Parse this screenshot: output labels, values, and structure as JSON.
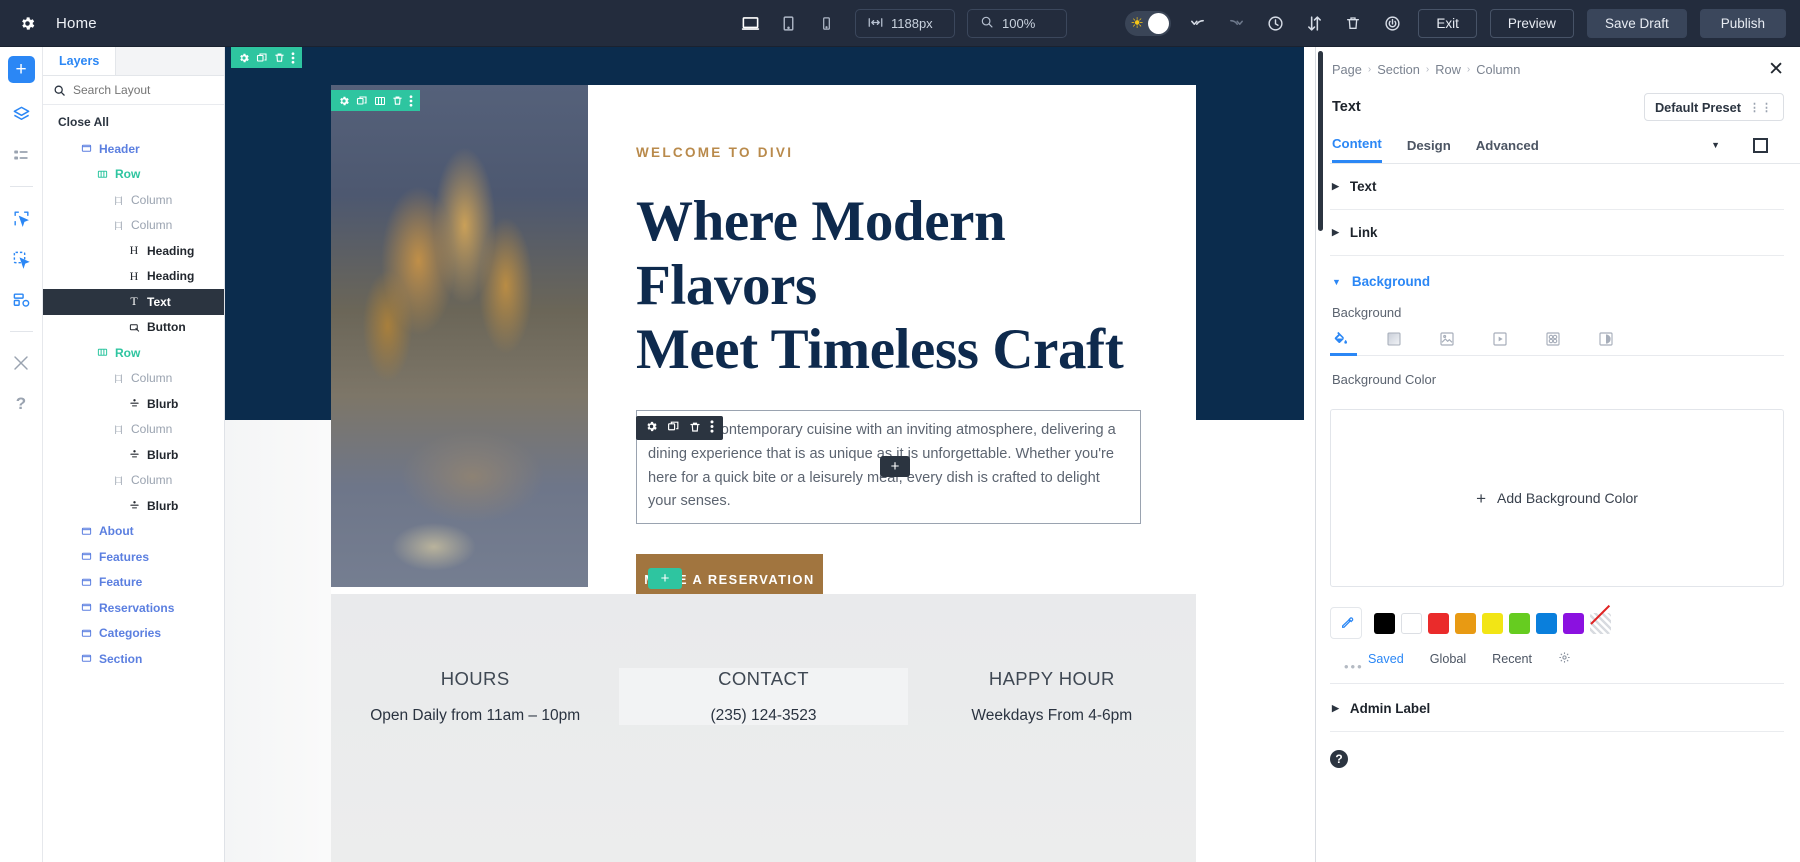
{
  "topbar": {
    "gear_icon": "gear-icon",
    "page_title": "Home",
    "devices": [
      {
        "name": "desktop",
        "icon": "desktop-icon",
        "active": true
      },
      {
        "name": "tablet",
        "icon": "tablet-icon",
        "active": false
      },
      {
        "name": "phone",
        "icon": "phone-icon",
        "active": false
      }
    ],
    "width_value": "1188px",
    "width_icon": "width-arrows-icon",
    "zoom_value": "100%",
    "zoom_icon": "magnifier-icon",
    "wireframe_toggle_icon": "sun-toggle-icon",
    "undo_icon": "undo-icon",
    "redo_icon": "redo-icon",
    "history_icon": "clock-history-icon",
    "portability_icon": "up-down-arrows-icon",
    "trash_icon": "trash-icon",
    "power_icon": "power-icon",
    "exit_label": "Exit",
    "preview_label": "Preview",
    "save_draft_label": "Save Draft",
    "publish_label": "Publish"
  },
  "rail": {
    "add_label": "+",
    "items": [
      {
        "name": "layers-icon"
      },
      {
        "name": "list-view-icon"
      },
      {
        "name": "select-element-icon"
      },
      {
        "name": "multiselect-icon"
      },
      {
        "name": "wireframe-icon"
      },
      {
        "name": "tools-icon"
      },
      {
        "name": "help-icon"
      }
    ]
  },
  "layers": {
    "tab_label": "Layers",
    "search_placeholder": "Search Layout",
    "search_value": "",
    "search_icon": "search-icon",
    "filter_icon": "filter-icon",
    "close_all_label": "Close All",
    "tree": [
      {
        "label": "Header",
        "type": "section",
        "icon": "section-icon"
      },
      {
        "label": "Row",
        "type": "row",
        "icon": "row-icon"
      },
      {
        "label": "Column",
        "type": "column",
        "icon": "column-icon"
      },
      {
        "label": "Column",
        "type": "column",
        "icon": "column-icon"
      },
      {
        "label": "Heading",
        "type": "module",
        "icon": "heading-icon"
      },
      {
        "label": "Heading",
        "type": "module",
        "icon": "heading-icon"
      },
      {
        "label": "Text",
        "type": "module",
        "icon": "text-icon",
        "selected": true
      },
      {
        "label": "Button",
        "type": "module",
        "icon": "button-icon"
      },
      {
        "label": "Row",
        "type": "row",
        "icon": "row-icon"
      },
      {
        "label": "Column",
        "type": "column",
        "icon": "column-icon"
      },
      {
        "label": "Blurb",
        "type": "module",
        "icon": "blurb-icon"
      },
      {
        "label": "Column",
        "type": "column",
        "icon": "column-icon"
      },
      {
        "label": "Blurb",
        "type": "module",
        "icon": "blurb-icon"
      },
      {
        "label": "Column",
        "type": "column",
        "icon": "column-icon"
      },
      {
        "label": "Blurb",
        "type": "module",
        "icon": "blurb-icon"
      },
      {
        "label": "About",
        "type": "section",
        "icon": "section-icon"
      },
      {
        "label": "Features",
        "type": "section",
        "icon": "section-icon"
      },
      {
        "label": "Feature",
        "type": "section",
        "icon": "section-icon"
      },
      {
        "label": "Reservations",
        "type": "section",
        "icon": "section-icon"
      },
      {
        "label": "Categories",
        "type": "section",
        "icon": "section-icon"
      },
      {
        "label": "Section",
        "type": "section",
        "icon": "section-icon"
      }
    ]
  },
  "canvas": {
    "section_toolbar_icons": [
      "gear-icon",
      "duplicate-icon",
      "trash-icon",
      "more-icon"
    ],
    "row_toolbar_icons": [
      "gear-icon",
      "duplicate-icon",
      "columns-icon",
      "trash-icon",
      "more-icon"
    ],
    "module_toolbar_icons": [
      "gear-icon",
      "duplicate-icon",
      "trash-icon",
      "more-icon"
    ],
    "eyebrow": "WELCOME TO DIVI",
    "heading_line1": "Where Modern Flavors",
    "heading_line2": "Meet Timeless Craft",
    "paragraph": "We blend contemporary cuisine with an inviting atmosphere, delivering a dining experience that is as unique as it is unforgettable. Whether you're here for a quick bite or a leisurely meal, every dish is crafted to delight your senses.",
    "cta_label": "MAKE A RESERVATION",
    "add_module_label": "+",
    "add_row_label": "+",
    "footer": [
      {
        "title": "HOURS",
        "value": "Open Daily from 11am – 10pm",
        "highlight": false
      },
      {
        "title": "CONTACT",
        "value": "(235) 124-3523",
        "highlight": true
      },
      {
        "title": "HAPPY HOUR",
        "value": "Weekdays From 4-6pm",
        "highlight": false
      }
    ]
  },
  "settings": {
    "breadcrumb": [
      "Page",
      "Section",
      "Row",
      "Column"
    ],
    "close_icon": "close-icon",
    "module_title": "Text",
    "preset_label": "Default Preset",
    "preset_icon": "preset-dots-icon",
    "tabs": [
      {
        "label": "Content",
        "active": true
      },
      {
        "label": "Design",
        "active": false
      },
      {
        "label": "Advanced",
        "active": false
      }
    ],
    "caret_icon": "chevron-down-icon",
    "expand_icon": "expand-square-icon",
    "sections": [
      {
        "label": "Text",
        "open": false
      },
      {
        "label": "Link",
        "open": false
      },
      {
        "label": "Background",
        "open": true
      },
      {
        "label": "Admin Label",
        "open": false
      }
    ],
    "background_label": "Background",
    "background_tabs": [
      {
        "name": "background-color-icon",
        "active": true
      },
      {
        "name": "background-gradient-icon",
        "active": false
      },
      {
        "name": "background-image-icon",
        "active": false
      },
      {
        "name": "background-video-icon",
        "active": false
      },
      {
        "name": "background-pattern-icon",
        "active": false
      },
      {
        "name": "background-mask-icon",
        "active": false
      }
    ],
    "background_color_label": "Background Color",
    "add_background_color_label": "Add Background Color",
    "eyedropper_icon": "eyedropper-icon",
    "swatches": [
      "#000000",
      "#ffffff",
      "#ea2b2b",
      "#e89a13",
      "#f2e515",
      "#66cc20",
      "#0a7fdc",
      "#8b11e0",
      "transparent"
    ],
    "swatch_links": [
      {
        "label": "Saved",
        "active": true
      },
      {
        "label": "Global",
        "active": false
      },
      {
        "label": "Recent",
        "active": false
      }
    ],
    "swatch_settings_icon": "gear-icon",
    "more_dots_icon": "more-dots-icon",
    "help_icon": "help-icon"
  },
  "colors": {
    "topbar_bg": "#232c3d",
    "accent_blue": "#2b87f5",
    "accent_green": "#2ec5a0",
    "dark": "#2b3440",
    "hero_navy": "#0b2c4d",
    "gold": "#b98a4b",
    "cta_brown": "#a1753f"
  }
}
